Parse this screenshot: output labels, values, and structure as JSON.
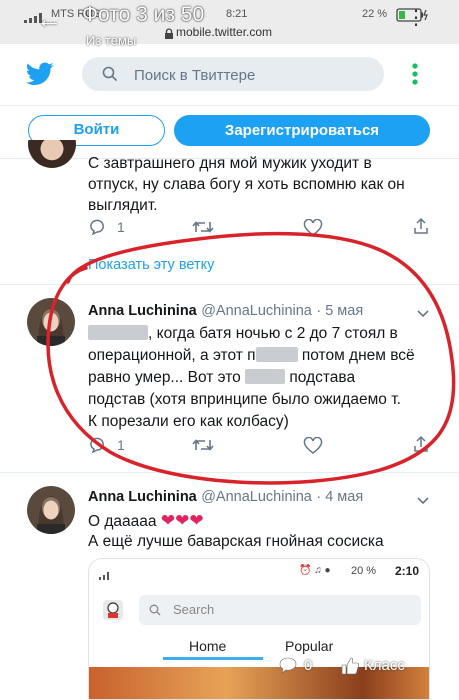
{
  "status_bar": {
    "carrier": "MTS RUS",
    "time": "8:21",
    "battery": "22 %"
  },
  "viewer": {
    "title": "Фото 3 из 50",
    "subtitle": "Из темы",
    "url": "mobile.twitter.com"
  },
  "header": {
    "search_placeholder": "Поиск в Твиттере",
    "login_label": "Войти",
    "register_label": "Зарегистрироваться"
  },
  "tweets": [
    {
      "text_lines": [
        "С завтрашнего дня мой мужик уходит в",
        "отпуск, ну слава богу я хоть вспомню как он",
        "выглядит."
      ],
      "replies": "1",
      "show_thread": "Показать эту ветку"
    },
    {
      "name": "Anna Luchinina",
      "handle": "@AnnaLuchinina",
      "date": "5 мая",
      "line1_b": ", когда батя  ночью с 2 до 7 стоял в",
      "line2": "операционной, а этот п",
      "line2_b": "потом днем всё",
      "line3": "равно умер... Вот это ",
      "line3_b": " подстава",
      "line4": "подстав (хотя впринципе было ожидаемо т.",
      "line5": "К порезали его как колбасу)",
      "replies": "1"
    },
    {
      "name": "Anna Luchinina",
      "handle": "@AnnaLuchinina",
      "date": "4 мая",
      "line1": "О дааааа",
      "line2": "А ещё лучше баварская гнойная сосиска"
    }
  ],
  "embed": {
    "time": "2:10",
    "battery": "20 %",
    "search_placeholder": "Search",
    "tab_home": "Home",
    "tab_popular": "Popular"
  },
  "footer": {
    "comments": "0",
    "like_label": "Класс"
  },
  "colors": {
    "twitter_blue": "#1da1f2",
    "annotation_red": "#d8232a",
    "heart_red": "#e0245e"
  }
}
